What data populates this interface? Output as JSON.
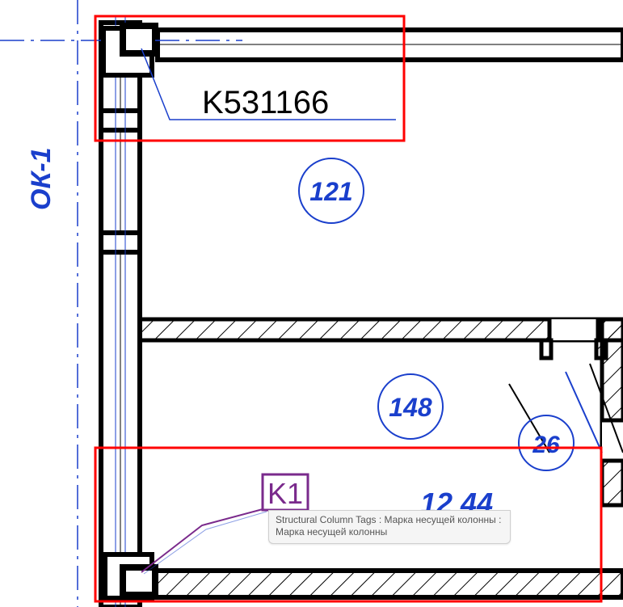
{
  "grid": {
    "axis_label": "ОК-1",
    "room_bubble_1": "121",
    "room_bubble_2": "148",
    "room_bubble_3": "26",
    "room_text_partial": "12 44"
  },
  "tags": {
    "column_tag_top": "K531166",
    "column_tag_bottom": "K1"
  },
  "tooltip": {
    "line1": "Structural Column Tags : Марка несущей колонны :",
    "line2": "Марка несущей колонны"
  },
  "highlights": {
    "top_box_color": "#ff0000",
    "bottom_box_color": "#ff0000",
    "selection_color": "#7a2a8c"
  }
}
